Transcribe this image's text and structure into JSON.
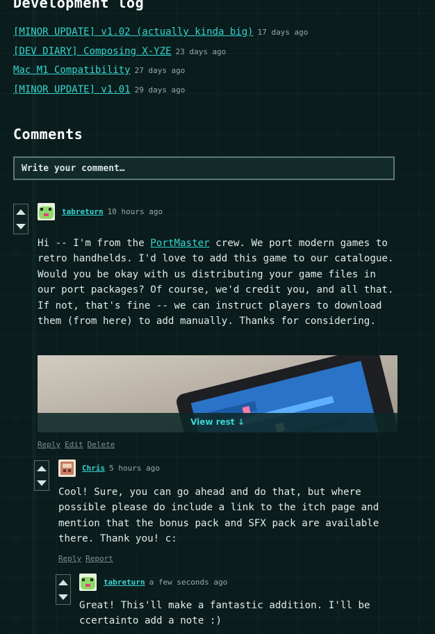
{
  "devlog": {
    "title": "Development log",
    "posts": [
      {
        "title": "[MINOR UPDATE] v1.02 (actually kinda big)",
        "time": "17 days ago"
      },
      {
        "title": "[DEV DIARY] Composing X-YZE",
        "time": "23 days ago"
      },
      {
        "title": "Mac M1 Compatibility",
        "time": "27 days ago"
      },
      {
        "title": "[MINOR UPDATE] v1.01",
        "time": "29 days ago"
      }
    ]
  },
  "comments": {
    "title": "Comments",
    "input_placeholder": "Write your comment…",
    "items": [
      {
        "author": "tabreturn",
        "time": "10 hours ago",
        "body_before_link": "Hi -- I'm from the ",
        "link_text": "PortMaster",
        "body_after_link": " crew. We port modern games to retro handhelds. I'd love to add this game to our catalogue. Would you be okay with us distributing your game files in our port packages? Of course, we'd credit you, and all that. If not, that's fine -- we can instruct players to download them (from here) to add manually. Thanks for considering.",
        "view_rest": "View rest ↓",
        "actions": [
          "Reply",
          "Edit",
          "Delete"
        ]
      },
      {
        "author": "Chris",
        "time": "5 hours ago",
        "body": "Cool! Sure, you can go ahead and do that, but where possible please do include a link to the itch page and mention that the bonus pack and SFX pack are available there. Thank you! c:",
        "actions": [
          "Reply",
          "Report"
        ]
      },
      {
        "author": "tabreturn",
        "time": "a few seconds ago",
        "body": "Great! This'll make a fantastic addition. I'll be ccertainto add a note :)"
      }
    ]
  },
  "colors": {
    "background": "#0a1c1c",
    "link": "#35d6d0",
    "text": "#e2ebea",
    "muted": "#9aaaa9"
  }
}
